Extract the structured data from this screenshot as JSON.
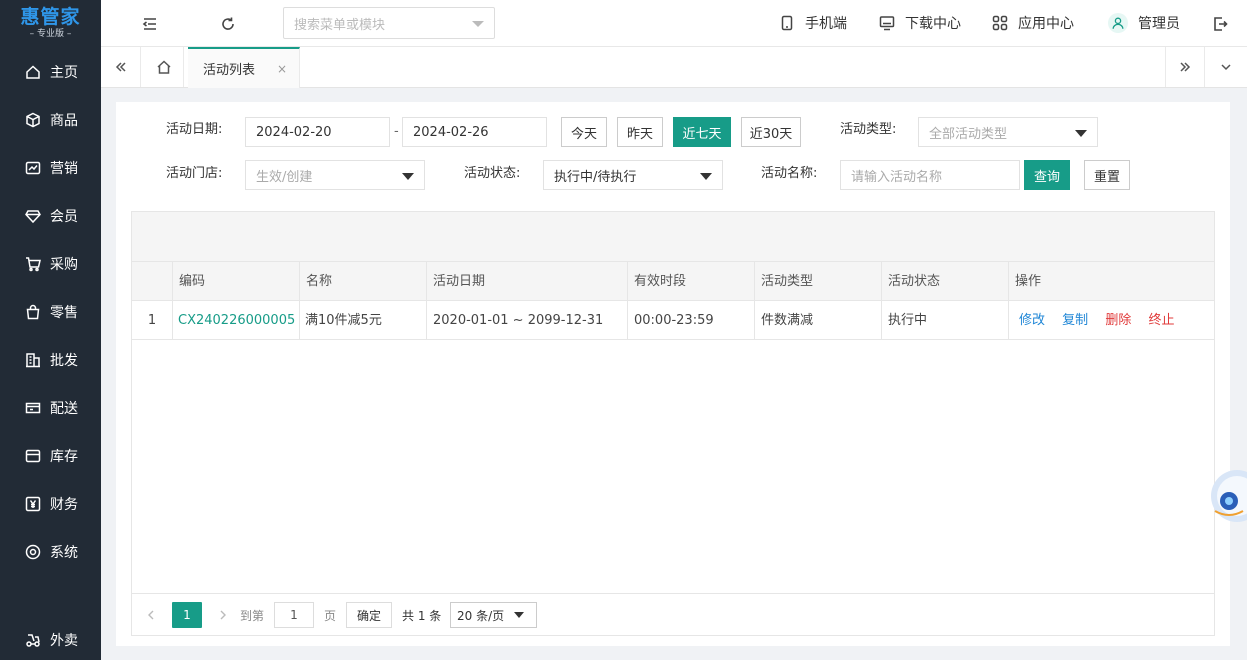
{
  "sidebar": {
    "logo_title": "惠管家",
    "logo_sub": "– 专业版 –",
    "items": [
      {
        "label": "主页",
        "icon": "home-icon"
      },
      {
        "label": "商品",
        "icon": "cube-icon"
      },
      {
        "label": "营销",
        "icon": "chart-icon"
      },
      {
        "label": "会员",
        "icon": "diamond-icon"
      },
      {
        "label": "采购",
        "icon": "cart-icon"
      },
      {
        "label": "零售",
        "icon": "bag-icon"
      },
      {
        "label": "批发",
        "icon": "building-icon"
      },
      {
        "label": "配送",
        "icon": "truck-icon"
      },
      {
        "label": "库存",
        "icon": "box-icon"
      },
      {
        "label": "财务",
        "icon": "yen-icon"
      },
      {
        "label": "系统",
        "icon": "gear-icon"
      }
    ],
    "bottom_item": {
      "label": "外卖",
      "icon": "delivery-icon"
    }
  },
  "topbar": {
    "search_placeholder": "搜索菜单或模块",
    "links": [
      {
        "label": "手机端",
        "icon": "mobile-icon"
      },
      {
        "label": "下载中心",
        "icon": "monitor-icon"
      },
      {
        "label": "应用中心",
        "icon": "apps-icon"
      },
      {
        "label": "管理员",
        "icon": "user-icon"
      }
    ]
  },
  "tabs": {
    "active_label": "活动列表",
    "close_glyph": "×"
  },
  "filters": {
    "date_label": "活动日期:",
    "date_start": "2024-02-20",
    "date_sep": "-",
    "date_end": "2024-02-26",
    "quick_today": "今天",
    "quick_yesterday": "昨天",
    "quick_7days": "近七天",
    "quick_30days": "近30天",
    "type_label": "活动类型:",
    "type_placeholder": "全部活动类型",
    "store_label": "活动门店:",
    "store_placeholder": "生效/创建",
    "status_label": "活动状态:",
    "status_value": "执行中/待执行",
    "name_label": "活动名称:",
    "name_placeholder": "请输入活动名称",
    "query_button": "查询",
    "reset_button": "重置"
  },
  "table": {
    "columns": [
      "编码",
      "名称",
      "活动日期",
      "有效时段",
      "活动类型",
      "活动状态",
      "操作"
    ],
    "rows": [
      {
        "index": "1",
        "code": "CX240226000005",
        "name": "满10件减5元",
        "date_range": "2020-01-01 ~ 2099-12-31",
        "time_range": "00:00-23:59",
        "type": "件数满减",
        "status": "执行中",
        "actions": [
          "修改",
          "复制",
          "删除",
          "终止"
        ]
      }
    ]
  },
  "pagination": {
    "current_page": "1",
    "goto_label": "到第",
    "goto_value": "1",
    "page_unit": "页",
    "confirm": "确定",
    "total": "共 1 条",
    "page_size": "20 条/页"
  },
  "colors": {
    "accent": "#179c88",
    "sidebar_bg": "#222b36",
    "link_blue": "#1f86d6",
    "danger_red": "#e03a3a"
  }
}
